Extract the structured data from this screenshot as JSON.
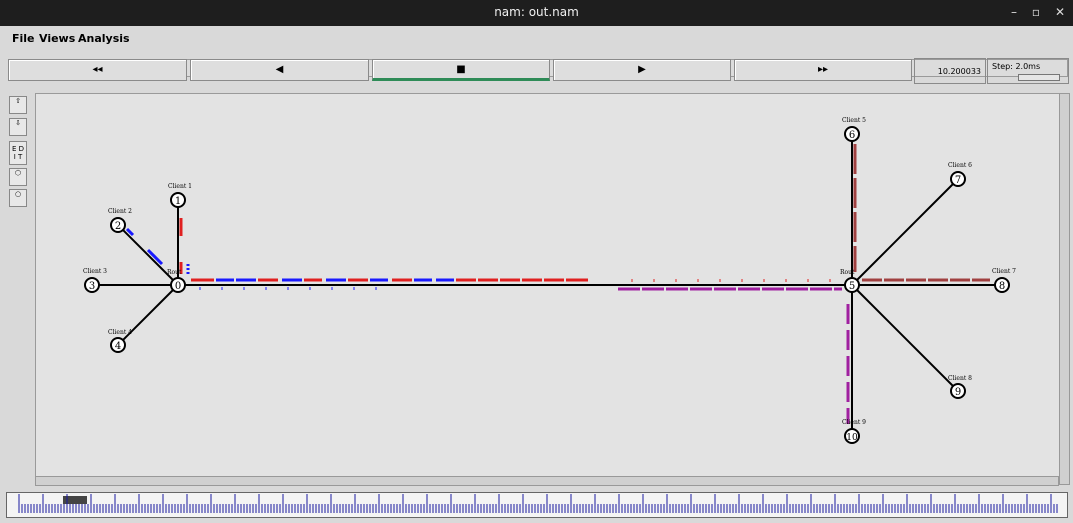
{
  "window": {
    "title": "nam: out.nam",
    "min_label": "–",
    "max_label": "▫",
    "close_label": "✕"
  },
  "menu": {
    "file": "File",
    "views": "Views",
    "analysis": "Analysis",
    "filename": "out.nam"
  },
  "controls": {
    "rewind": "◂◂",
    "back": "◀",
    "stop": "■",
    "play": "▶",
    "ffwd": "▸▸"
  },
  "time": "10.200033",
  "step": "Step: 2.0ms",
  "tools": {
    "edit": "E D\nI T"
  },
  "nodes": [
    {
      "id": "0",
      "label": "Rout"
    },
    {
      "id": "1",
      "label": "Client 1"
    },
    {
      "id": "2",
      "label": "Client 2"
    },
    {
      "id": "3",
      "label": "Client 3"
    },
    {
      "id": "4",
      "label": "Client 4"
    },
    {
      "id": "5",
      "label": "Rout"
    },
    {
      "id": "6",
      "label": "Client 5"
    },
    {
      "id": "7",
      "label": "Client 6"
    },
    {
      "id": "8",
      "label": "Client 7"
    },
    {
      "id": "9",
      "label": "Client 8"
    },
    {
      "id": "10",
      "label": "Client 9"
    }
  ],
  "colors": {
    "flow_red": "#e02020",
    "flow_blue": "#1a1aff",
    "flow_purple": "#a020a0",
    "flow_brown": "#a04040",
    "link": "#000000",
    "accent": "#2e8b57"
  }
}
